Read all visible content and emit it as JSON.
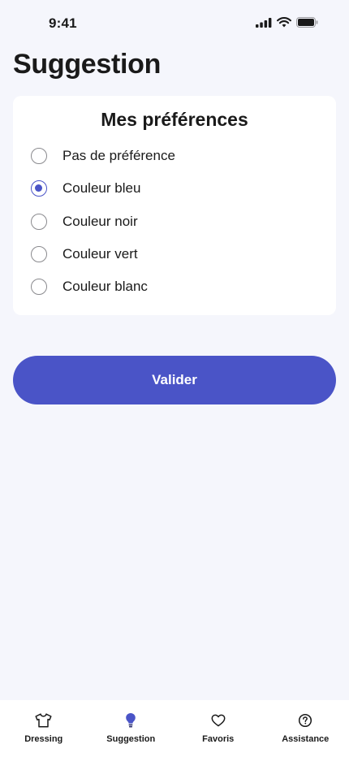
{
  "status_bar": {
    "time": "9:41"
  },
  "page": {
    "title": "Suggestion"
  },
  "preferences": {
    "title": "Mes préférences",
    "options": [
      {
        "label": "Pas de préférence",
        "checked": false
      },
      {
        "label": "Couleur bleu",
        "checked": true
      },
      {
        "label": "Couleur noir",
        "checked": false
      },
      {
        "label": "Couleur vert",
        "checked": false
      },
      {
        "label": "Couleur blanc",
        "checked": false
      }
    ]
  },
  "actions": {
    "submit_label": "Valider"
  },
  "tab_bar": {
    "items": [
      {
        "label": "Dressing",
        "icon": "tshirt-icon"
      },
      {
        "label": "Suggestion",
        "icon": "lightbulb-icon",
        "active": true
      },
      {
        "label": "Favoris",
        "icon": "heart-icon"
      },
      {
        "label": "Assistance",
        "icon": "help-circle-icon"
      }
    ]
  },
  "colors": {
    "accent": "#4a54c7",
    "background": "#f5f6fc",
    "card": "#ffffff"
  }
}
